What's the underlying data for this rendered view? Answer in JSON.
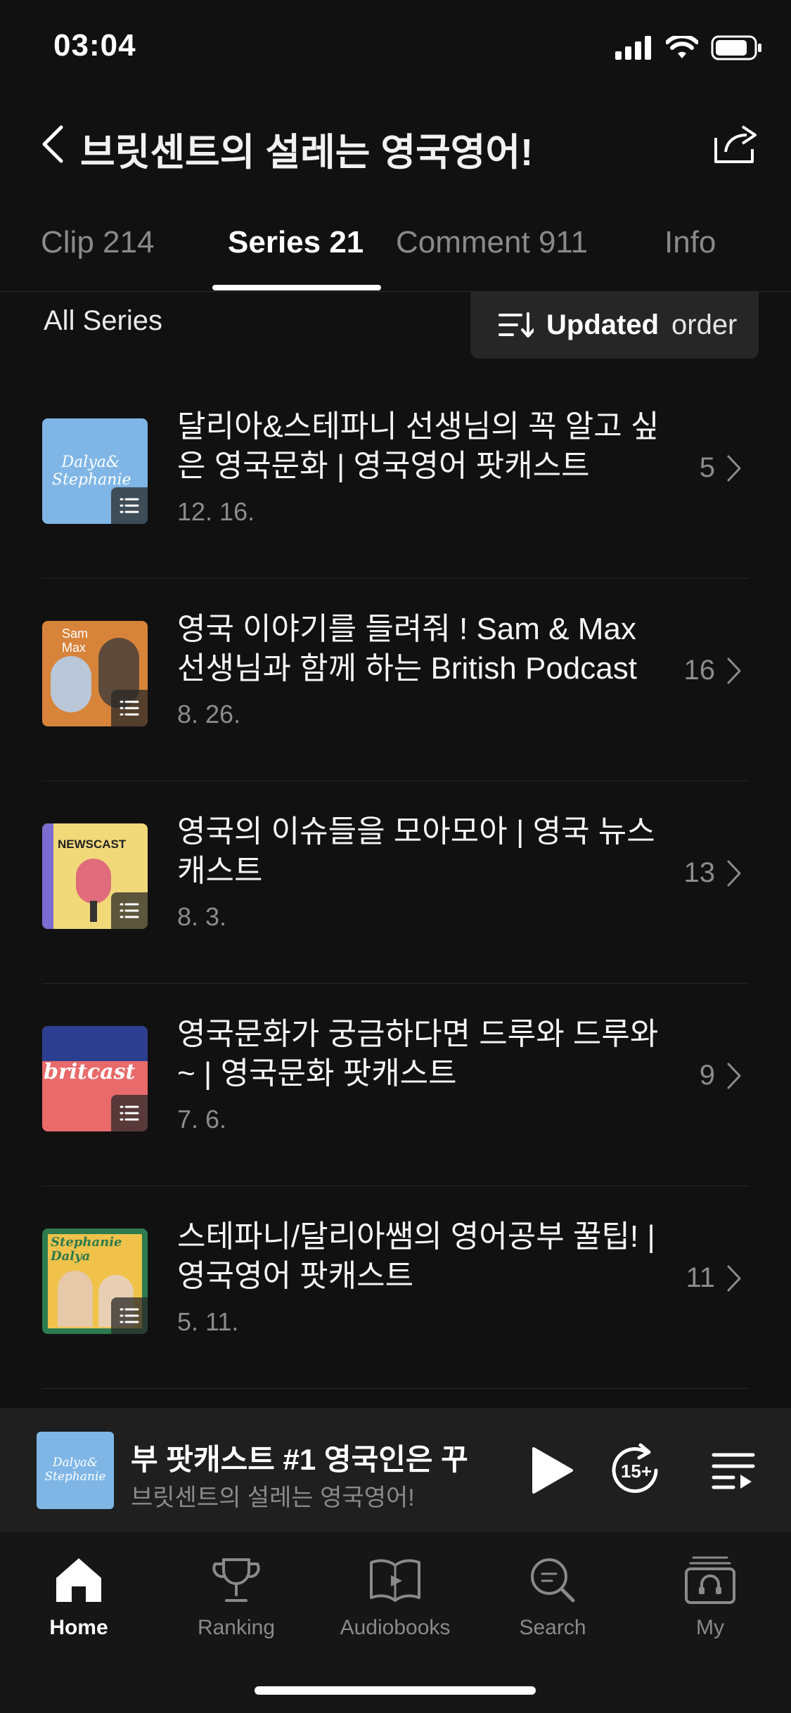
{
  "status_bar": {
    "time": "03:04"
  },
  "header": {
    "title": "브릿센트의 설레는 영국영어!"
  },
  "tabs": [
    {
      "label": "Clip 214"
    },
    {
      "label": "Series 21"
    },
    {
      "label": "Comment 911"
    },
    {
      "label": "Info"
    }
  ],
  "filter": {
    "label": "All Series",
    "sort_strong": "Updated",
    "sort_rest": "order"
  },
  "series": [
    {
      "title": "달리아&스테파니 선생님의 꼭 알고 싶은 영국문화 | 영국영어 팟캐스트",
      "date": "12. 16.",
      "count": "5",
      "thumb_color": "#7fb6e6",
      "thumb_text": "Dalya& Stephanie"
    },
    {
      "title": "영국 이야기를 들려줘 ! Sam & Max 선생님과 함께 하는 British Podcast",
      "date": "8. 26.",
      "count": "16",
      "thumb_color": "#d7843a",
      "thumb_text": "Sam Max"
    },
    {
      "title": "영국의 이슈들을 모아모아 | 영국 뉴스캐스트",
      "date": "8. 3.",
      "count": "13",
      "thumb_color": "#f1d97a",
      "thumb_text": "NEWSCAST"
    },
    {
      "title": "영국문화가 궁금하다면 드루와 드루와~ | 영국문화 팟캐스트",
      "date": "7. 6.",
      "count": "9",
      "thumb_color": "#e86a6a",
      "thumb_text": "britcast"
    },
    {
      "title": "스테파니/달리아쌤의 영어공부 꿀팁! | 영국영어 팟캐스트",
      "date": "5. 11.",
      "count": "11",
      "thumb_color": "#2e7a4f",
      "thumb_text": "Stephanie Dalya"
    }
  ],
  "player": {
    "title": "부 팟캐스트 #1        영국인은 꾸",
    "subtitle": "브릿센트의 설레는 영국영어!",
    "skip_label": "15+",
    "thumb_text": "Dalya& Stephanie"
  },
  "nav": [
    {
      "label": "Home",
      "icon": "home-icon"
    },
    {
      "label": "Ranking",
      "icon": "trophy-icon"
    },
    {
      "label": "Audiobooks",
      "icon": "audiobook-icon"
    },
    {
      "label": "Search",
      "icon": "search-icon"
    },
    {
      "label": "My",
      "icon": "my-library-icon"
    }
  ]
}
